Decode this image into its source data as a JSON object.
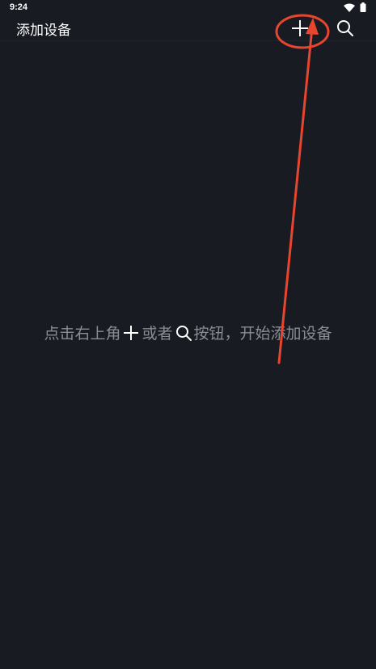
{
  "status_bar": {
    "time": "9:24",
    "icons": [
      "wifi-icon",
      "battery-icon"
    ]
  },
  "app_bar": {
    "title": "添加设备",
    "actions": [
      "plus-icon",
      "search-icon"
    ]
  },
  "empty_state": {
    "text_before_plus": "点击右上角",
    "text_between": "或者",
    "text_after_search": "按钮，开始添加设备"
  },
  "colors": {
    "background": "#181b22",
    "title_text": "#ffffff",
    "hint_text": "#8a8d94",
    "annotation": "#e8452f"
  }
}
